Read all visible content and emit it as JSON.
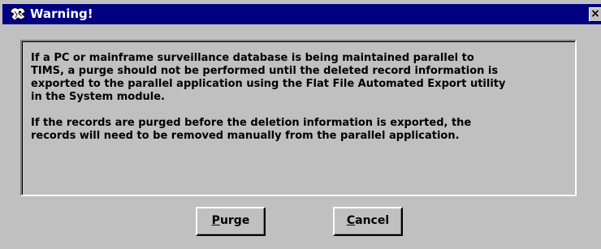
{
  "window": {
    "title": "Warning!",
    "close_glyph": "×",
    "icon": "warning-icon",
    "colors": {
      "titlebar": "#000080",
      "face": "#c0c0c0",
      "text": "#000000"
    }
  },
  "message": {
    "paragraph1_lines": [
      "If a PC or mainframe surveillance database is being maintained parallel to",
      "TIMS, a purge should not be performed until the deleted record information is",
      "exported to the parallel application using the Flat File Automated Export utility",
      "in the System module."
    ],
    "paragraph2_lines": [
      "If the records are purged before the deletion information is exported, the",
      "records will need to be removed manually from the parallel application."
    ]
  },
  "buttons": {
    "purge": {
      "accel": "P",
      "rest": "urge"
    },
    "cancel": {
      "accel": "C",
      "rest": "ancel"
    }
  }
}
